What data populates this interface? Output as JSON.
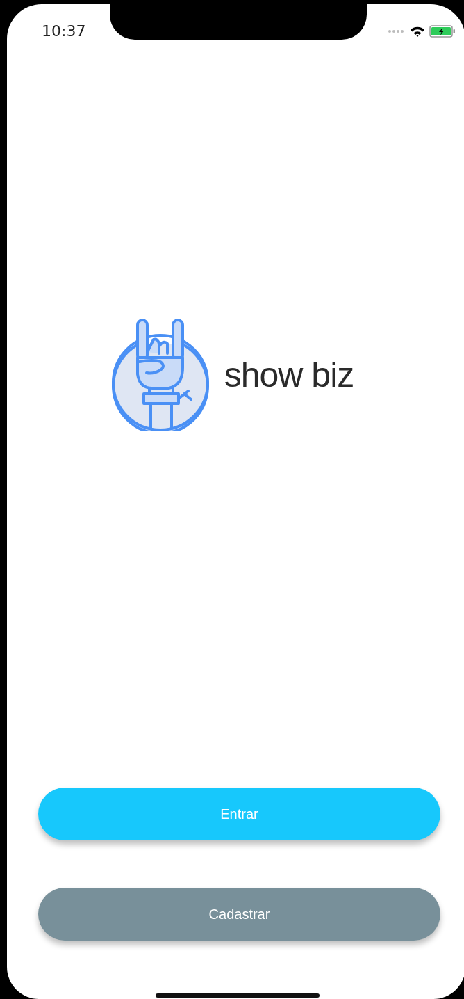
{
  "status_bar": {
    "time": "10:37"
  },
  "logo": {
    "text": "show biz"
  },
  "buttons": [
    {
      "label": "Entrar",
      "kind": "primary"
    },
    {
      "label": "Cadastrar",
      "kind": "secondary"
    }
  ]
}
